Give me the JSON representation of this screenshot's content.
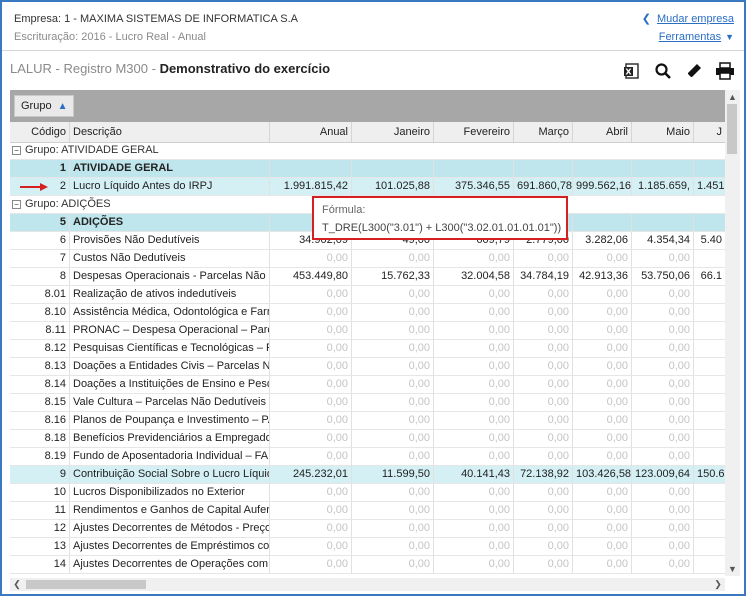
{
  "header": {
    "empresa": "Empresa: 1 - MAXIMA SISTEMAS DE INFORMATICA S.A",
    "escrituracao": "Escrituração: 2016 - Lucro Real - Anual",
    "mudar_empresa": "Mudar empresa",
    "ferramentas": "Ferramentas"
  },
  "title": {
    "prefix": "LALUR - Registro M300 - ",
    "main": "Demonstrativo do exercício"
  },
  "toolbar_icons": [
    "excel-export-icon",
    "search-icon",
    "edit-pencil-icon",
    "print-icon"
  ],
  "group_button": "Grupo",
  "columns": {
    "codigo": "Código",
    "descricao": "Descrição",
    "anual": "Anual",
    "janeiro": "Janeiro",
    "fevereiro": "Fevereiro",
    "marco": "Março",
    "abril": "Abril",
    "maio": "Maio",
    "jun": "J"
  },
  "groups": {
    "g1": "Grupo: ATIVIDADE GERAL",
    "g2": "Grupo: ADIÇÕES"
  },
  "rows": [
    {
      "codigo": "1",
      "descricao": "ATIVIDADE GERAL",
      "anual": "",
      "jan": "",
      "fev": "",
      "mar": "",
      "abr": "",
      "mai": "",
      "jun": ""
    },
    {
      "codigo": "2",
      "descricao": "Lucro Líquido Antes do IRPJ",
      "anual": "1.991.815,42",
      "jan": "101.025,88",
      "fev": "375.346,55",
      "mar": "691.860,78",
      "abr": "999.562,16",
      "mai": "1.185.659,",
      "jun": "1.451"
    },
    {
      "codigo": "5",
      "descricao": "ADIÇÕES",
      "anual": "",
      "jan": "",
      "fev": "",
      "mar": "",
      "abr": "",
      "mai": "",
      "jun": ""
    },
    {
      "codigo": "6",
      "descricao": "Provisões Não Dedutíveis",
      "anual": "34.902,09",
      "jan": "49,00",
      "fev": "609,79",
      "mar": "2.779,00",
      "abr": "3.282,06",
      "mai": "4.354,34",
      "jun": "5.40"
    },
    {
      "codigo": "7",
      "descricao": "Custos Não Dedutíveis",
      "anual": "0,00",
      "jan": "0,00",
      "fev": "0,00",
      "mar": "0,00",
      "abr": "0,00",
      "mai": "0,00",
      "jun": ""
    },
    {
      "codigo": "8",
      "descricao": "Despesas Operacionais - Parcelas Não De",
      "anual": "453.449,80",
      "jan": "15.762,33",
      "fev": "32.004,58",
      "mar": "34.784,19",
      "abr": "42.913,36",
      "mai": "53.750,06",
      "jun": "66.1"
    },
    {
      "codigo": "8.01",
      "descricao": "Realização de ativos indedutíveis",
      "anual": "0,00",
      "jan": "0,00",
      "fev": "0,00",
      "mar": "0,00",
      "abr": "0,00",
      "mai": "0,00",
      "jun": ""
    },
    {
      "codigo": "8.10",
      "descricao": "Assistência Médica, Odontológica e Farm",
      "anual": "0,00",
      "jan": "0,00",
      "fev": "0,00",
      "mar": "0,00",
      "abr": "0,00",
      "mai": "0,00",
      "jun": ""
    },
    {
      "codigo": "8.11",
      "descricao": "PRONAC – Despesa Operacional – Parcel",
      "anual": "0,00",
      "jan": "0,00",
      "fev": "0,00",
      "mar": "0,00",
      "abr": "0,00",
      "mai": "0,00",
      "jun": ""
    },
    {
      "codigo": "8.12",
      "descricao": "Pesquisas Científicas e Tecnológicas – Pa",
      "anual": "0,00",
      "jan": "0,00",
      "fev": "0,00",
      "mar": "0,00",
      "abr": "0,00",
      "mai": "0,00",
      "jun": ""
    },
    {
      "codigo": "8.13",
      "descricao": "Doações a Entidades Civis – Parcelas Não",
      "anual": "0,00",
      "jan": "0,00",
      "fev": "0,00",
      "mar": "0,00",
      "abr": "0,00",
      "mai": "0,00",
      "jun": ""
    },
    {
      "codigo": "8.14",
      "descricao": "Doações a Instituições de Ensino e Pesqu",
      "anual": "0,00",
      "jan": "0,00",
      "fev": "0,00",
      "mar": "0,00",
      "abr": "0,00",
      "mai": "0,00",
      "jun": ""
    },
    {
      "codigo": "8.15",
      "descricao": "Vale Cultura – Parcelas Não Dedutíveis",
      "anual": "0,00",
      "jan": "0,00",
      "fev": "0,00",
      "mar": "0,00",
      "abr": "0,00",
      "mai": "0,00",
      "jun": ""
    },
    {
      "codigo": "8.16",
      "descricao": "Planos de Poupança e Investimento – PA",
      "anual": "0,00",
      "jan": "0,00",
      "fev": "0,00",
      "mar": "0,00",
      "abr": "0,00",
      "mai": "0,00",
      "jun": ""
    },
    {
      "codigo": "8.18",
      "descricao": "Benefícios Previdenciários a Empregados",
      "anual": "0,00",
      "jan": "0,00",
      "fev": "0,00",
      "mar": "0,00",
      "abr": "0,00",
      "mai": "0,00",
      "jun": ""
    },
    {
      "codigo": "8.19",
      "descricao": "Fundo de Aposentadoria Individual – FAF",
      "anual": "0,00",
      "jan": "0,00",
      "fev": "0,00",
      "mar": "0,00",
      "abr": "0,00",
      "mai": "0,00",
      "jun": ""
    },
    {
      "codigo": "9",
      "descricao": "Contribuição Social Sobre o Lucro Líquido",
      "anual": "245.232,01",
      "jan": "11.599,50",
      "fev": "40.141,43",
      "mar": "72.138,92",
      "abr": "103.426,58",
      "mai": "123.009,64",
      "jun": "150.6"
    },
    {
      "codigo": "10",
      "descricao": "Lucros Disponibilizados no Exterior",
      "anual": "0,00",
      "jan": "0,00",
      "fev": "0,00",
      "mar": "0,00",
      "abr": "0,00",
      "mai": "0,00",
      "jun": ""
    },
    {
      "codigo": "11",
      "descricao": "Rendimentos e Ganhos de Capital Auferic",
      "anual": "0,00",
      "jan": "0,00",
      "fev": "0,00",
      "mar": "0,00",
      "abr": "0,00",
      "mai": "0,00",
      "jun": ""
    },
    {
      "codigo": "12",
      "descricao": "Ajustes Decorrentes de Métodos - Preços",
      "anual": "0,00",
      "jan": "0,00",
      "fev": "0,00",
      "mar": "0,00",
      "abr": "0,00",
      "mai": "0,00",
      "jun": ""
    },
    {
      "codigo": "13",
      "descricao": "Ajustes Decorrentes de Empréstimos com",
      "anual": "0,00",
      "jan": "0,00",
      "fev": "0,00",
      "mar": "0,00",
      "abr": "0,00",
      "mai": "0,00",
      "jun": ""
    },
    {
      "codigo": "14",
      "descricao": "Ajustes Decorrentes de Operações com F",
      "anual": "0,00",
      "jan": "0,00",
      "fev": "0,00",
      "mar": "0,00",
      "abr": "0,00",
      "mai": "0,00",
      "jun": ""
    }
  ],
  "tooltip": {
    "label": "Fórmula:",
    "formula": "T_DRE(L300(\"3.01\") + L300(\"3.02.01.01.01.01\"))"
  },
  "colors": {
    "accent": "#2a6fc4",
    "highlight_row": "#bfe6ec",
    "tooltip_border": "#d42020",
    "arrow": "#d42020",
    "frame_border": "#3a78c2"
  }
}
